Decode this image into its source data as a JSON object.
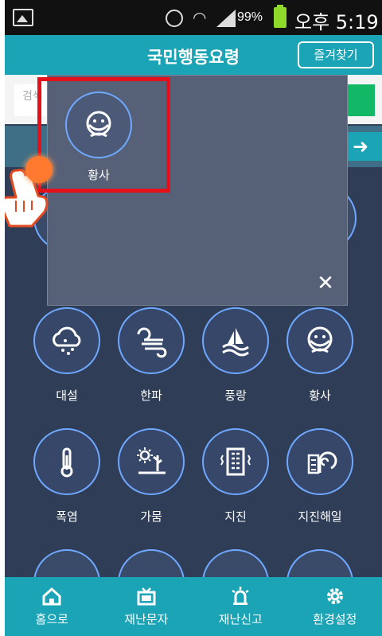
{
  "status_bar": {
    "battery_percent": "99%",
    "time": "오후 5:19"
  },
  "header": {
    "title": "국민행동요령",
    "favorites_button": "즐겨찾기"
  },
  "search": {
    "placeholder": "검색"
  },
  "popup": {
    "item_label": "황사",
    "close_glyph": "✕"
  },
  "categories": [
    {
      "label": "대설",
      "icon": "snow-cloud-icon"
    },
    {
      "label": "한파",
      "icon": "cold-wind-icon"
    },
    {
      "label": "풍랑",
      "icon": "wind-wave-icon"
    },
    {
      "label": "황사",
      "icon": "mask-face-icon"
    },
    {
      "label": "폭염",
      "icon": "thermometer-icon"
    },
    {
      "label": "가뭄",
      "icon": "drought-icon"
    },
    {
      "label": "지진",
      "icon": "building-icon"
    },
    {
      "label": "지진해일",
      "icon": "tsunami-icon"
    }
  ],
  "bottom_nav": [
    {
      "label": "홈으로",
      "icon": "home-icon"
    },
    {
      "label": "재난문자",
      "icon": "tv-icon"
    },
    {
      "label": "재난신고",
      "icon": "siren-icon"
    },
    {
      "label": "환경설정",
      "icon": "gear-icon"
    }
  ],
  "colors": {
    "accent": "#1aa4b5",
    "background": "#2f3d57",
    "circle_border": "#6fa8ff",
    "highlight": "#e5101a"
  }
}
